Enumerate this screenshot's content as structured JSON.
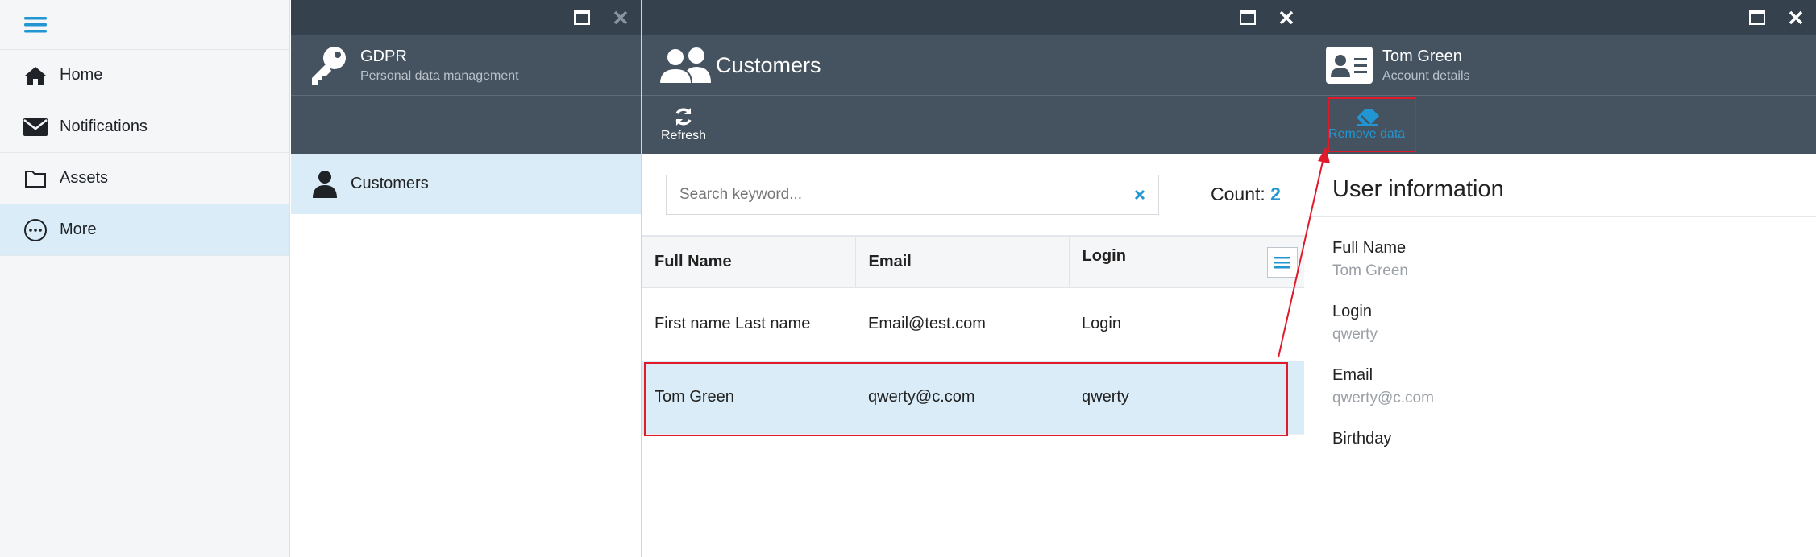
{
  "nav": {
    "items": [
      {
        "label": "Home",
        "icon": "home-icon"
      },
      {
        "label": "Notifications",
        "icon": "envelope-icon"
      },
      {
        "label": "Assets",
        "icon": "folder-icon"
      },
      {
        "label": "More",
        "icon": "more-icon"
      }
    ]
  },
  "gdpr": {
    "title": "GDPR",
    "subtitle": "Personal data management",
    "items": [
      {
        "label": "Customers"
      }
    ]
  },
  "customers": {
    "title": "Customers",
    "refresh_label": "Refresh",
    "search_placeholder": "Search keyword...",
    "count_label": "Count:",
    "count_value": "2",
    "columns": [
      "Full Name",
      "Email",
      "Login"
    ],
    "rows": [
      [
        "First name Last name",
        "Email@test.com",
        "Login"
      ],
      [
        "Tom Green",
        "qwerty@c.com",
        "qwerty"
      ]
    ]
  },
  "details": {
    "title": "Tom Green",
    "subtitle": "Account details",
    "remove_label": "Remove data",
    "section_title": "User information",
    "fields": [
      {
        "label": "Full Name",
        "value": "Tom Green"
      },
      {
        "label": "Login",
        "value": "qwerty"
      },
      {
        "label": "Email",
        "value": "qwerty@c.com"
      },
      {
        "label": "Birthday",
        "value": ""
      }
    ]
  },
  "colors": {
    "accent": "#2196d3",
    "header_dark": "#35414d",
    "header": "#45525f",
    "highlight": "#d9ecf8",
    "annotation": "#e0192b"
  }
}
